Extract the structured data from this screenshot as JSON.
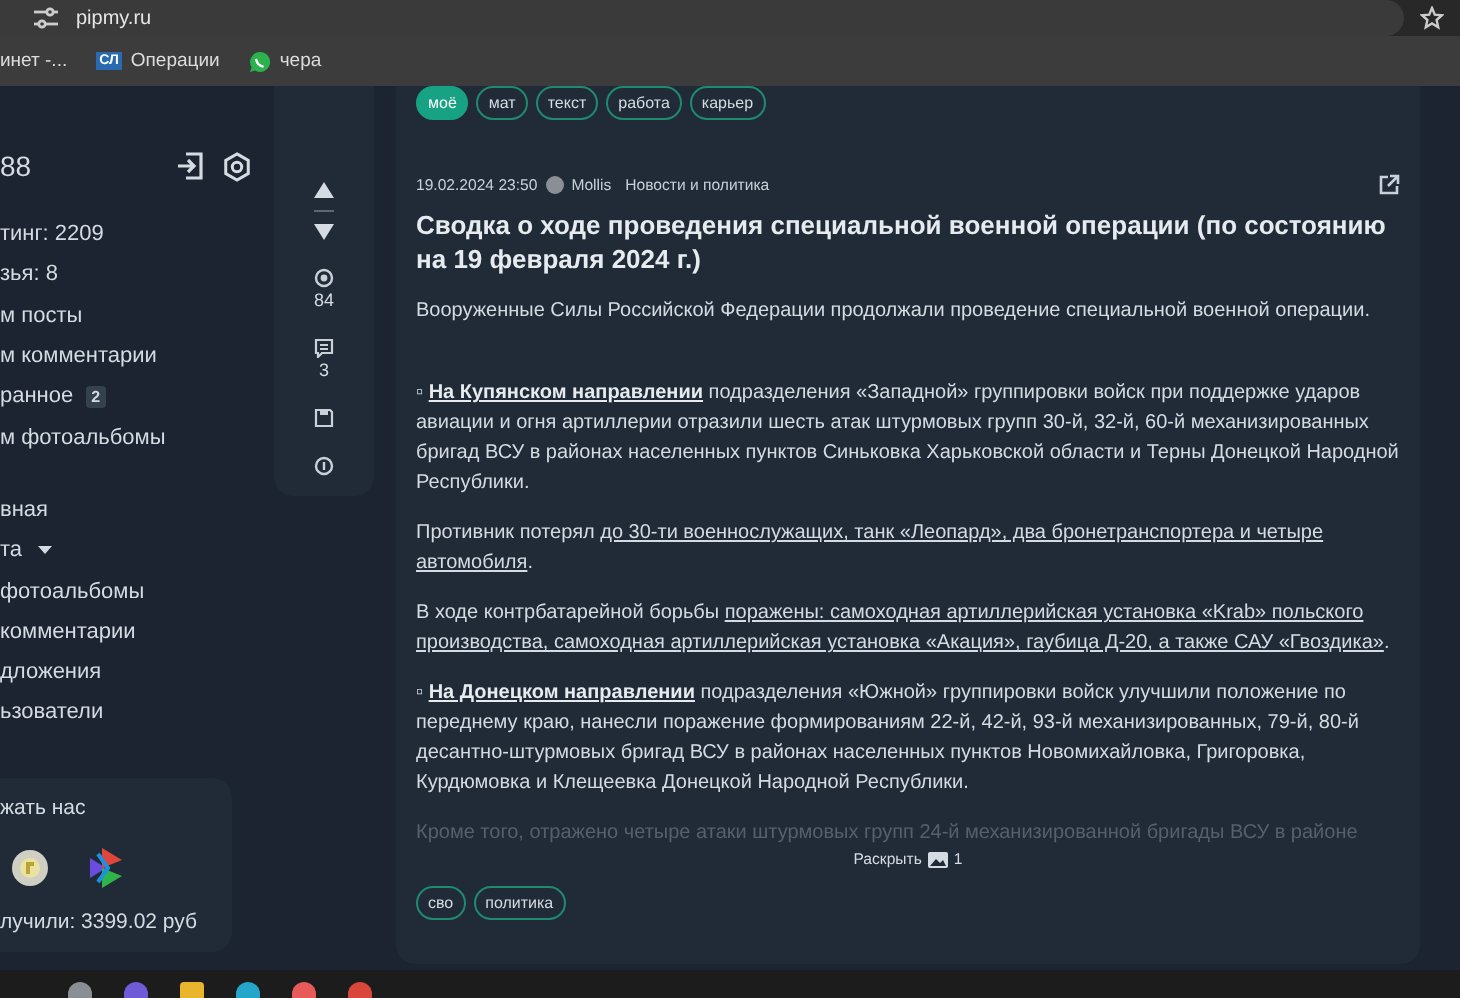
{
  "browser": {
    "url": "pipmy.ru",
    "bookmarks": [
      {
        "label": "инет -...",
        "kind": "plain"
      },
      {
        "label": "Операции",
        "kind": "badge",
        "badge": "СЛ"
      },
      {
        "label": "чера",
        "kind": "chat"
      }
    ]
  },
  "sidebar": {
    "username": "88",
    "stats": [
      "тинг: 2209",
      "зья: 8"
    ],
    "my_links": [
      {
        "label": "м посты"
      },
      {
        "label": "м комментарии"
      },
      {
        "label": "ранное",
        "badge": "2"
      },
      {
        "label": "м фотоальбомы"
      }
    ],
    "nav": [
      {
        "label": "вная",
        "dropdown": false
      },
      {
        "label": "та",
        "dropdown": true
      },
      {
        "label": "фотоальбомы",
        "dropdown": false
      },
      {
        "label": "комментарии",
        "dropdown": false
      },
      {
        "label": "дложения",
        "dropdown": false
      },
      {
        "label": "ьзователи",
        "dropdown": false
      }
    ],
    "support": {
      "title": "жать нас",
      "total": "лучили: 3399.02 руб"
    }
  },
  "prev_post": {
    "tags": [
      {
        "label": "моё",
        "selected": true
      },
      {
        "label": "мат",
        "selected": false
      },
      {
        "label": "текст",
        "selected": false
      },
      {
        "label": "работа",
        "selected": false
      },
      {
        "label": "карьер",
        "selected": false
      }
    ]
  },
  "post": {
    "views": "84",
    "comments": "3",
    "date": "19.02.2024 23:50",
    "author": "Mollis",
    "category": "Новости и политика",
    "title": "Сводка о ходе проведения специальной военной операции (по состоянию на 19 февраля 2024 г.)",
    "paragraphs": [
      [
        {
          "kind": "text",
          "text": "Вооруженные Силы Российской Федерации продолжали проведение специальной военной операции."
        }
      ],
      [
        {
          "kind": "text",
          "text": "▫ "
        },
        {
          "kind": "strong-link",
          "text": "На Купянском направлении"
        },
        {
          "kind": "text",
          "text": " подразделения «Западной» группировки войск при поддержке ударов авиации и огня артиллерии отразили шесть атак штурмовых групп 30-й, 32-й, 60-й механизированных бригад ВСУ в районах населенных пунктов Синьковка Харьковской области и Терны Донецкой Народной Республики."
        }
      ],
      [
        {
          "kind": "text",
          "text": "Противник потерял "
        },
        {
          "kind": "underline",
          "text": "до 30-ти военнослужащих, танк «Леопард», два бронетранспортера и четыре автомобиля"
        },
        {
          "kind": "text",
          "text": "."
        }
      ],
      [
        {
          "kind": "text",
          "text": "В ходе контрбатарейной борьбы "
        },
        {
          "kind": "underline",
          "text": "поражены: самоходная артиллерийская установка «Krab» польского производства, самоходная артиллерийская установка «Акация», гаубица Д-20, а также САУ «Гвоздика»"
        },
        {
          "kind": "text",
          "text": "."
        }
      ],
      [
        {
          "kind": "text",
          "text": "▫ "
        },
        {
          "kind": "strong-link",
          "text": "На Донецком направлении"
        },
        {
          "kind": "text",
          "text": " подразделения «Южной» группировки войск улучшили положение по переднему краю, нанесли поражение формированиям 22-й, 42-й, 93-й механизированных, 79-й, 80-й десантно-штурмовых бригад ВСУ в районах населенных пунктов Новомихайловка, Григоровка, Курдюмовка и Клещеевка Донецкой Народной Республики."
        }
      ]
    ],
    "faded_text": "Кроме того, отражено четыре атаки штурмовых групп 24-й механизированной бригады ВСУ в районе",
    "expand": {
      "label": "Раскрыть",
      "images": "1"
    },
    "tags": [
      "сво",
      "политика"
    ]
  }
}
